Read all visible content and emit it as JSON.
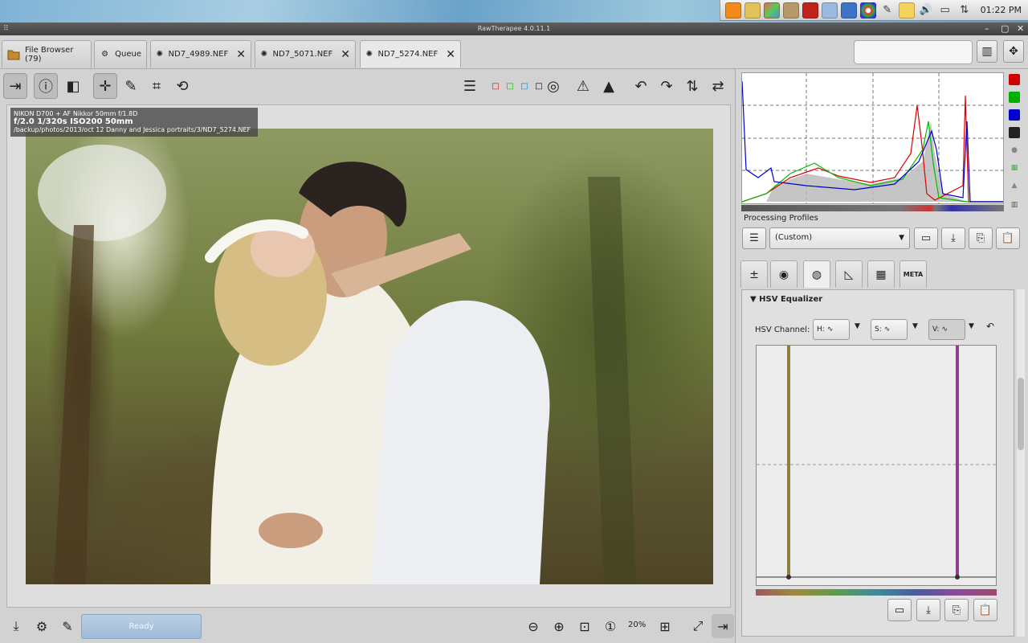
{
  "window": {
    "title": "RawTherapee 4.0.11.1"
  },
  "tray": {
    "clock": "01:22 PM"
  },
  "tabs": [
    {
      "label": "File Browser (79)"
    },
    {
      "label": "Queue"
    },
    {
      "label": "ND7_4989.NEF"
    },
    {
      "label": "ND7_5071.NEF"
    },
    {
      "label": "ND7_5274.NEF"
    }
  ],
  "info": {
    "camera": "NIKON D700 + AF Nikkor 50mm f/1.8D",
    "exposure": "f/2.0  1/320s  ISO200  50mm",
    "path": "/backup/photos/2013/oct 12 Danny and Jessica portraits/3/ND7_5274.NEF"
  },
  "status": {
    "ready": "Ready",
    "zoom": "20%"
  },
  "colors": {
    "accent": "#9fbad6",
    "red": "#d00000",
    "green": "#00b000",
    "blue": "#0000d0"
  },
  "panel": {
    "profiles_label": "Processing Profiles",
    "profile_value": "(Custom)",
    "hsv_title": "HSV Equalizer",
    "hsv_channel_label": "HSV Channel:",
    "ch_h": "H:",
    "ch_s": "S:",
    "ch_v": "V:",
    "meta_tab": "META"
  }
}
